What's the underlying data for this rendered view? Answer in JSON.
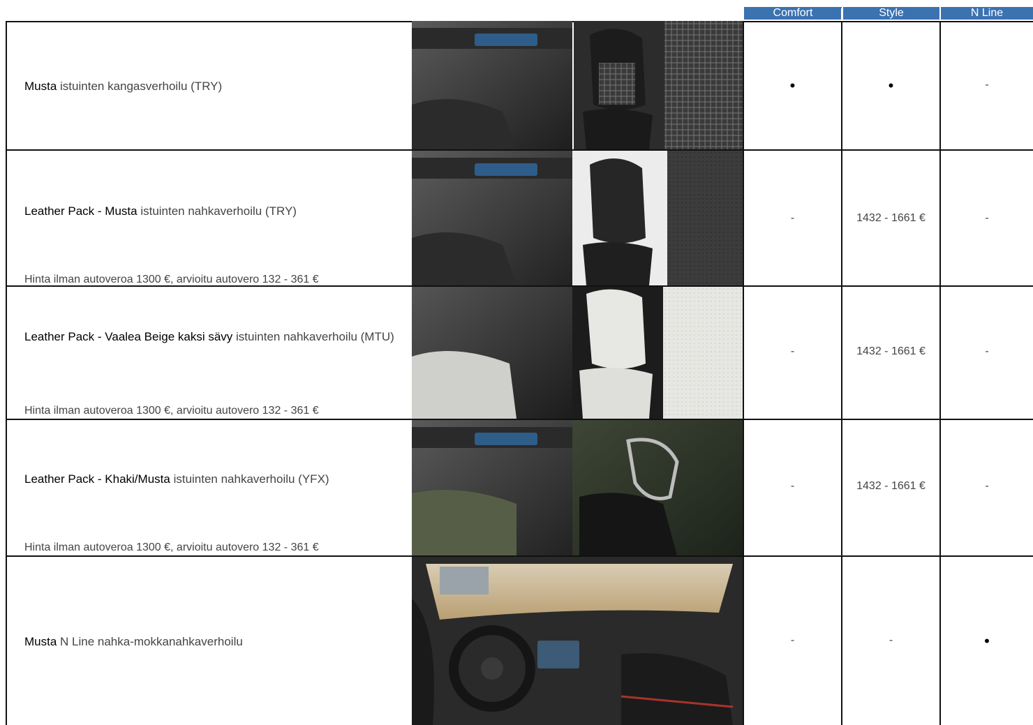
{
  "headers": [
    "Comfort",
    "Style",
    "N Line"
  ],
  "rows": [
    {
      "name_bold": "Musta",
      "name_rest": "istuinten kangasverhoilu (TRY)",
      "note": "",
      "cells": [
        "•",
        "•",
        "-"
      ]
    },
    {
      "name_bold": "Leather Pack - Musta",
      "name_rest": "istuinten nahkaverhoilu (TRY)",
      "note": "Hinta ilman autoveroa 1300 €, arvioitu autovero 132 - 361 €",
      "cells": [
        "-",
        "1432 - 1661 €",
        "-"
      ]
    },
    {
      "name_bold": "Leather Pack - Vaalea Beige kaksi sävy",
      "name_rest": "istuinten nahkaverhoilu (MTU)",
      "note": "Hinta ilman autoveroa 1300 €, arvioitu autovero 132 - 361 €",
      "cells": [
        "-",
        "1432 - 1661 €",
        "-"
      ]
    },
    {
      "name_bold": "Leather Pack - Khaki/Musta",
      "name_rest": "istuinten nahkaverhoilu (YFX)",
      "note": "Hinta ilman autoveroa 1300 €, arvioitu autovero 132 - 361 €",
      "cells": [
        "-",
        "1432 - 1661 €",
        "-"
      ]
    },
    {
      "name_bold": "Musta",
      "name_rest": "N Line nahka-mokkanahkaverhoilu",
      "note": "",
      "cells": [
        "-",
        "-",
        "•"
      ]
    }
  ],
  "colors": {
    "header_bg": "#3b72b0",
    "grid": "#111111"
  }
}
